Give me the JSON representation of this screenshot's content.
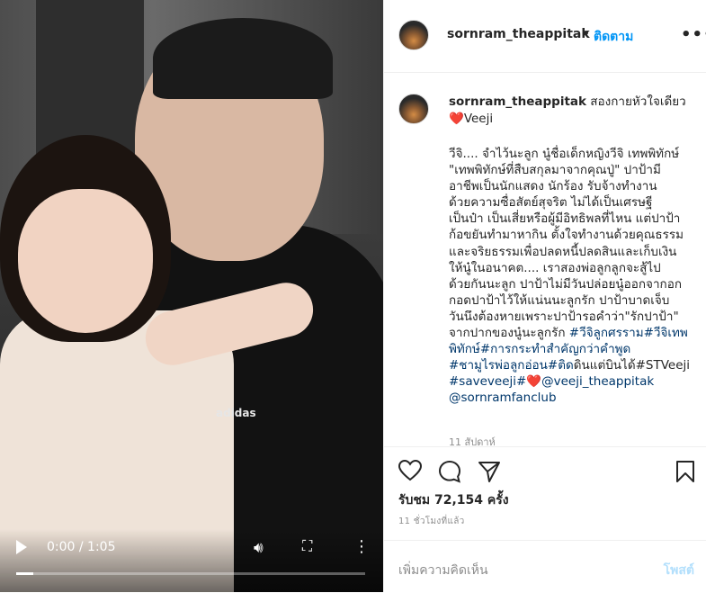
{
  "video": {
    "time": "0:00 / 1:05",
    "progress": 0.05,
    "shirt_logo": "adidas"
  },
  "header": {
    "username": "sornram_theappitak",
    "separator": "•",
    "follow_label": "ติดตาม",
    "more_label": "•••"
  },
  "caption": {
    "username": "sornram_theappitak",
    "headline": "สองกายหัวใจเดียว",
    "heart": "❤️",
    "headline_tail": "Veeji",
    "body": "วีจิ.... จำไว้นะลูก นู๋ชื่อเด็กหญิงวีจิ เทพพิทักษ์\n\"เทพพิทักษ์ที่สืบสกุลมาจากคุณปู่\" ปาป้ามี\nอาชีพเป็นนักแสดง นักร้อง รับจ้างทำงาน\nด้วยความซื่อสัตย์สุจริต ไม่ได้เป็นเศรษฐี\nเป็นป๋า เป็นเสี่ยหรือผู้มีอิทธิพลที่ไหน แต่ปาป้า\nก้อขยันทำมาหากิน ตั้งใจทำงานด้วยคุณธรรม\nและจริยธรรมเพื่อปลดหนี้ปลดสินและเก็บเงิน\nให้นู๋ในอนาคต.... เราสองพ่อลูกลูกจะสู้ไป\nด้วยกันนะลูก ปาป้าไม่มีวันปล่อยนู๋ออกจากอก\nกอดปาป้าไว้ให้แน่นนะลูกรัก ปาป้าบาดเจ็บ\nวันนึงต้องหายเพราะปาป้ารอคำว่า\"รักปาป้า\"",
    "line12_prefix": "จากปากของนู๋นะลูกรัก ",
    "tag1": "#วีจิลูกศรราม",
    "tag2": "#วีจิเทพ",
    "line13_prefix": "พิทักษ์",
    "tag3": "#การกระทำสำคัญกว่าคำพูด",
    "tag4": "#ชามูไรพ่อลูกอ่อน",
    "tag5": "#ติด",
    "line14_mid": "ดินแต่บินได้#STVeeji",
    "tag6": "#saveveeji",
    "hash_heart": "#",
    "mention1": "@veeji_theappitak",
    "mention2": "@sornramfanclub",
    "age": "11 สัปดาห์"
  },
  "actions": {
    "views": "รับชม 72,154 ครั้ง",
    "posted": "11 ชั่วโมงที่แล้ว"
  },
  "comment": {
    "placeholder": "เพิ่มความคิดเห็น",
    "post_label": "โพสต์"
  },
  "colors": {
    "link": "#00376b",
    "follow": "#0095f6",
    "heart": "#ed4956"
  }
}
